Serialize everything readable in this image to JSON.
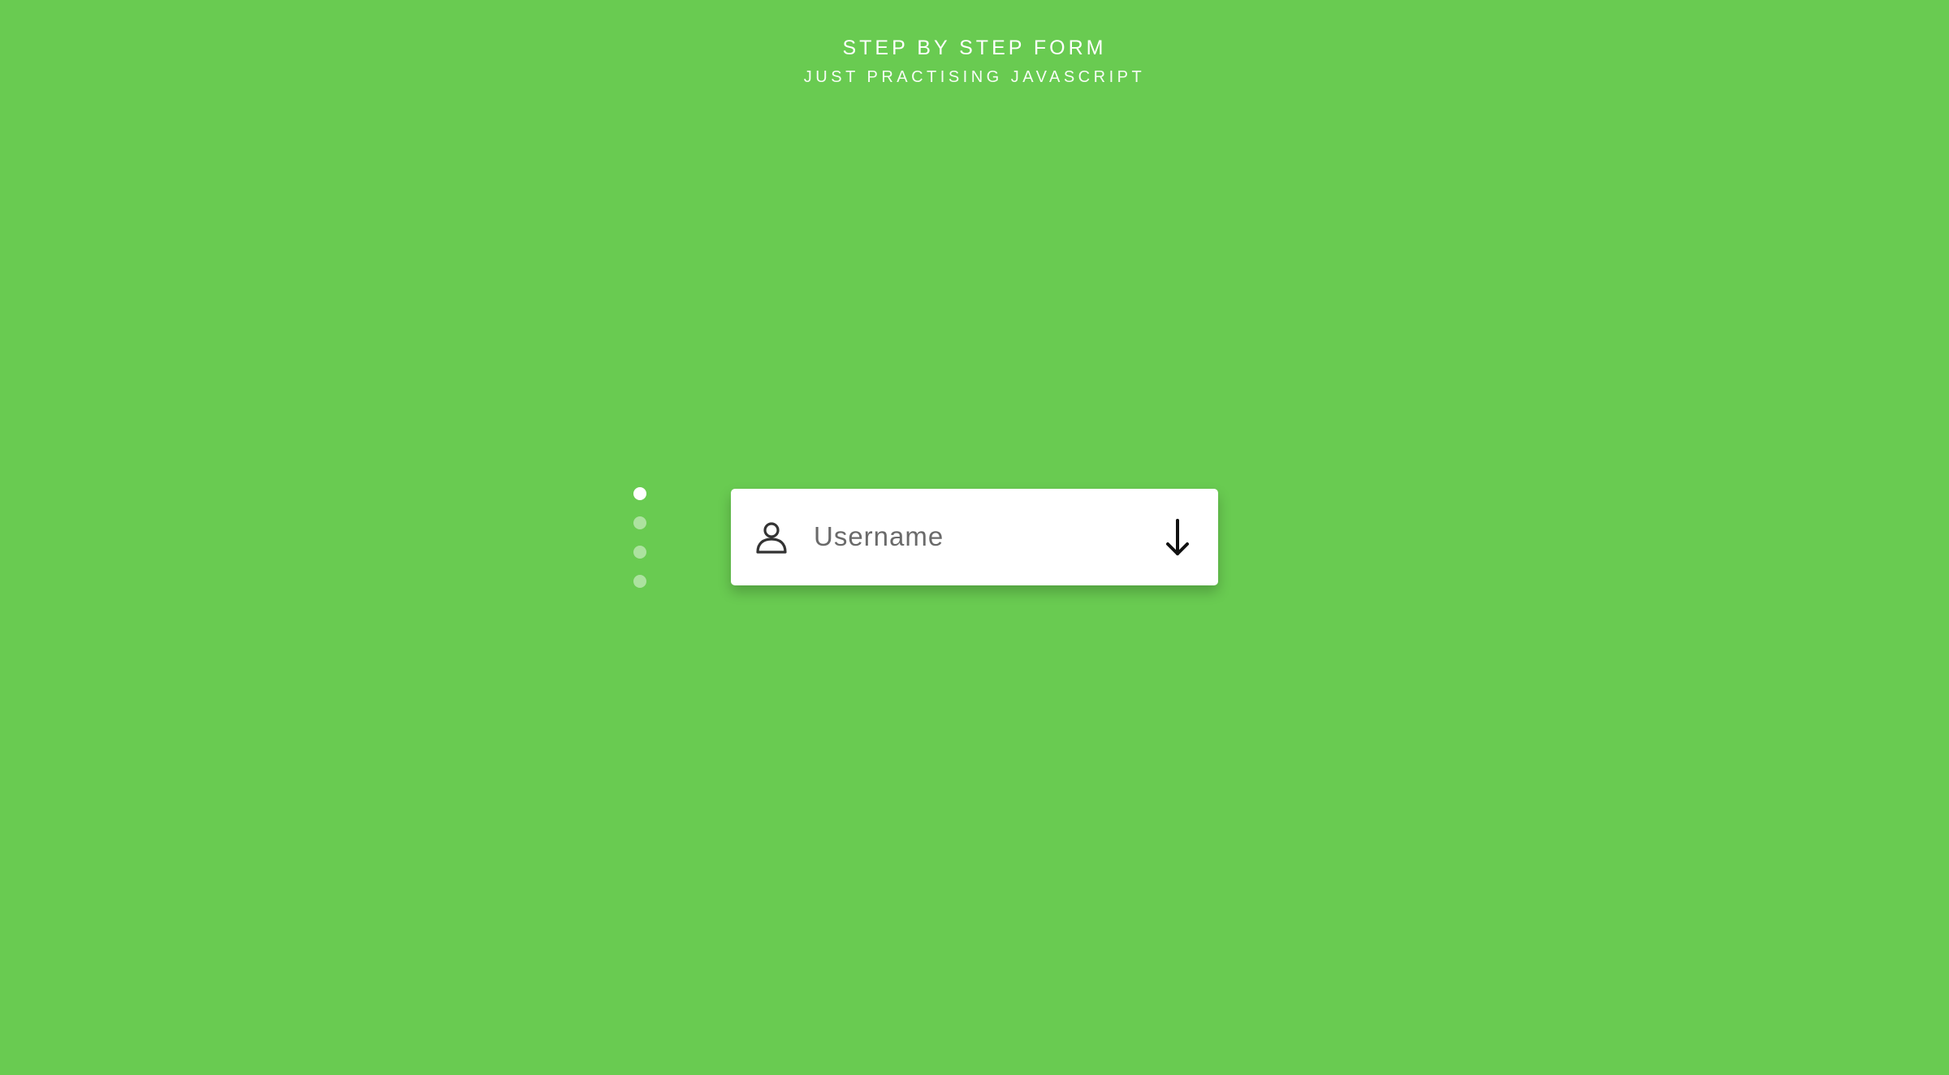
{
  "colors": {
    "background": "#69cb51",
    "card": "#ffffff",
    "dot_active": "#ffffff",
    "dot_inactive": "rgba(255,255,255,0.45)",
    "icon": "#333333",
    "arrow": "#111111"
  },
  "header": {
    "title": "STEP BY STEP FORM",
    "subtitle": "JUST PRACTISING JAVASCRIPT"
  },
  "progress": {
    "total_steps": 4,
    "current_step": 1
  },
  "form": {
    "icon": "user-icon",
    "value": "",
    "placeholder": "Username",
    "next_icon": "arrow-down-icon"
  }
}
